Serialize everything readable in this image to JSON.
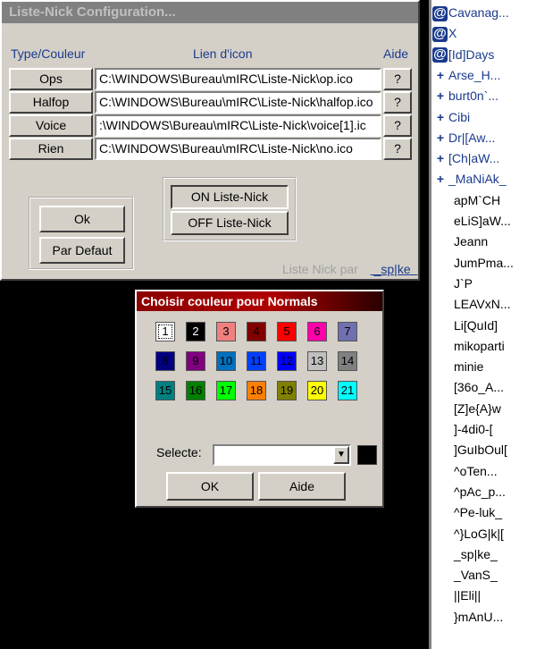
{
  "config_window": {
    "title": "Liste-Nick Configuration...",
    "headers": {
      "type": "Type/Couleur",
      "link": "Lien d'icon",
      "help": "Aide"
    },
    "rows": [
      {
        "type": "Ops",
        "path": "C:\\WINDOWS\\Bureau\\mIRC\\Liste-Nick\\op.ico",
        "help": "?"
      },
      {
        "type": "Halfop",
        "path": "C:\\WINDOWS\\Bureau\\mIRC\\Liste-Nick\\halfop.ico",
        "help": "?"
      },
      {
        "type": "Voice",
        "path": ":\\WINDOWS\\Bureau\\mIRC\\Liste-Nick\\voice[1].ic",
        "help": "?"
      },
      {
        "type": "Rien",
        "path": "C:\\WINDOWS\\Bureau\\mIRC\\Liste-Nick\\no.ico",
        "help": "?"
      }
    ],
    "ok_label": "Ok",
    "default_label": "Par Defaut",
    "on_label": "ON Liste-Nick",
    "off_label": "OFF Liste-Nick",
    "credit_prefix": "Liste Nick par",
    "credit_link": "sp|ke"
  },
  "color_dialog": {
    "title": "Choisir couleur pour Normals",
    "swatches": [
      {
        "n": "1",
        "color": "#ffffff",
        "text": "#000000"
      },
      {
        "n": "2",
        "color": "#000000",
        "text": "#ffffff"
      },
      {
        "n": "3",
        "color": "#f08080",
        "text": "#000000"
      },
      {
        "n": "4",
        "color": "#800000",
        "text": "#000000"
      },
      {
        "n": "5",
        "color": "#ff0000",
        "text": "#000000"
      },
      {
        "n": "6",
        "color": "#ff00aa",
        "text": "#000000"
      },
      {
        "n": "7",
        "color": "#7070b0",
        "text": "#000000"
      },
      {
        "n": "8",
        "color": "#000080",
        "text": "#000000"
      },
      {
        "n": "9",
        "color": "#800080",
        "text": "#000000"
      },
      {
        "n": "10",
        "color": "#0070c0",
        "text": "#000000"
      },
      {
        "n": "11",
        "color": "#0040ff",
        "text": "#000000"
      },
      {
        "n": "12",
        "color": "#0000ff",
        "text": "#000000"
      },
      {
        "n": "13",
        "color": "#c0c0c0",
        "text": "#000000"
      },
      {
        "n": "14",
        "color": "#808080",
        "text": "#000000"
      },
      {
        "n": "15",
        "color": "#008080",
        "text": "#000000"
      },
      {
        "n": "16",
        "color": "#008000",
        "text": "#000000"
      },
      {
        "n": "17",
        "color": "#00ff00",
        "text": "#000000"
      },
      {
        "n": "18",
        "color": "#ff8000",
        "text": "#000000"
      },
      {
        "n": "19",
        "color": "#808000",
        "text": "#000000"
      },
      {
        "n": "20",
        "color": "#ffff00",
        "text": "#000000"
      },
      {
        "n": "21",
        "color": "#00ffff",
        "text": "#000000"
      }
    ],
    "select_label": "Selecte:",
    "select_value": "",
    "ok_label": "OK",
    "help_label": "Aide"
  },
  "nicklist": {
    "items": [
      {
        "kind": "op",
        "icon": "at-op-icon",
        "label": "Cavanag..."
      },
      {
        "kind": "op",
        "icon": "at-op-icon",
        "label": "X"
      },
      {
        "kind": "op",
        "icon": "at-op-icon",
        "label": "[Id]Days"
      },
      {
        "kind": "voice",
        "icon": "plus-voice-icon",
        "label": "Arse_H..."
      },
      {
        "kind": "voice",
        "icon": "plus-voice-icon",
        "label": "burt0n`..."
      },
      {
        "kind": "voice",
        "icon": "plus-voice-icon",
        "label": "Cibi"
      },
      {
        "kind": "voice",
        "icon": "plus-voice-icon",
        "label": "Dr|[Aw..."
      },
      {
        "kind": "voice",
        "icon": "plus-voice-icon",
        "label": "[Ch|aW..."
      },
      {
        "kind": "voice",
        "icon": "plus-voice-icon",
        "label": "_MaNiAk_"
      },
      {
        "kind": "normal",
        "label": "apM`CH"
      },
      {
        "kind": "normal",
        "label": "eLiS]aW..."
      },
      {
        "kind": "normal",
        "label": "Jeann"
      },
      {
        "kind": "normal",
        "label": "JumPma..."
      },
      {
        "kind": "normal",
        "label": "J`P"
      },
      {
        "kind": "normal",
        "label": "LEAVxN..."
      },
      {
        "kind": "normal",
        "label": "Li[QuId]"
      },
      {
        "kind": "normal",
        "label": "mikoparti"
      },
      {
        "kind": "normal",
        "label": "minie"
      },
      {
        "kind": "normal",
        "label": "[36o_A..."
      },
      {
        "kind": "normal",
        "label": "[Z]e{A}w"
      },
      {
        "kind": "normal",
        "label": "]-4di0-["
      },
      {
        "kind": "normal",
        "label": "]GuIbOul["
      },
      {
        "kind": "normal",
        "label": "^oTen..."
      },
      {
        "kind": "normal",
        "label": "^pAc_p..."
      },
      {
        "kind": "normal",
        "label": "^Pe-luk_"
      },
      {
        "kind": "normal",
        "label": "^}LoG|k|["
      },
      {
        "kind": "normal",
        "label": "_sp|ke_"
      },
      {
        "kind": "normal",
        "label": "_VanS_"
      },
      {
        "kind": "normal",
        "label": "||Eli||"
      },
      {
        "kind": "normal",
        "label": "}mAnU..."
      }
    ]
  }
}
